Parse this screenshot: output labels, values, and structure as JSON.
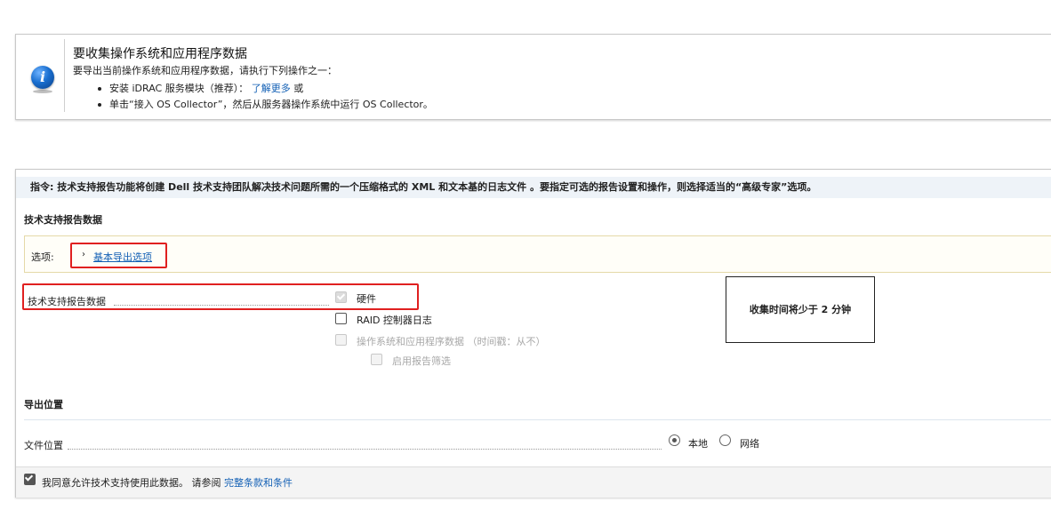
{
  "info": {
    "title": "要收集操作系统和应用程序数据",
    "subtitle": "要导出当前操作系统和应用程序数据，请执行下列操作之一：",
    "item1_text": "安装 iDRAC 服务模块（推荐）：",
    "item1_link": "了解更多",
    "item1_suffix": "或",
    "item2_text": "单击“接入 OS Collector”，然后从服务器操作系统中运行 OS Collector。",
    "icon": "info-icon",
    "icon_glyph": "i"
  },
  "instruction": "指令: 技术支持报告功能将创建 Dell 技术支持团队解决技术问题所需的一个压缩格式的 XML 和文本基的日志文件 。要指定可选的报告设置和操作，则选择适当的“高级专家”选项。",
  "section_report_title": "技术支持报告数据",
  "options": {
    "label": "选项:",
    "chevron": "›",
    "link": "基本导出选项"
  },
  "report_data": {
    "label": "技术支持报告数据",
    "checkboxes": [
      {
        "label": "硬件",
        "checked": true,
        "disabled": true
      },
      {
        "label": "RAID 控制器日志",
        "checked": false,
        "disabled": false
      },
      {
        "label": "操作系统和应用程序数据 （时间戳：从不）",
        "checked": false,
        "disabled": true
      },
      {
        "label": "启用报告筛选",
        "checked": false,
        "disabled": true
      }
    ]
  },
  "collect_time": "收集时间将少于 2 分钟",
  "export": {
    "title": "导出位置",
    "file_location_label": "文件位置",
    "radio_local": "本地",
    "radio_network": "网络",
    "selected": "本地"
  },
  "footer": {
    "agree_text": "我同意允许技术支持使用此数据。 请参阅",
    "terms_link": "完整条款和条件",
    "checked": true
  },
  "colors": {
    "link": "#1360b5",
    "highlight": "#e02020",
    "instruction_bg": "#eef3f8"
  }
}
